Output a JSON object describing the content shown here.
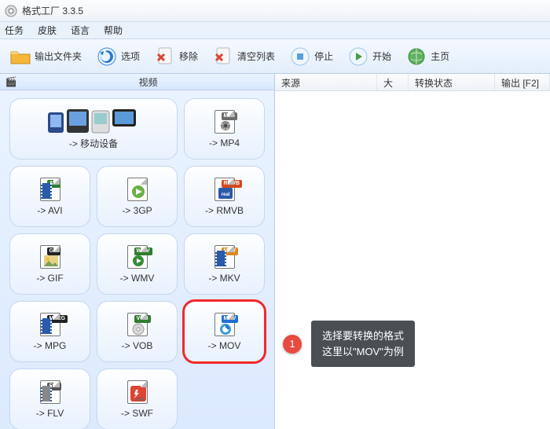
{
  "window": {
    "title": "格式工厂 3.3.5"
  },
  "menu": {
    "task": "任务",
    "skin": "皮肤",
    "lang": "语言",
    "help": "帮助"
  },
  "toolbar": {
    "output": "输出文件夹",
    "options": "选项",
    "remove": "移除",
    "clear": "清空列表",
    "stop": "停止",
    "start": "开始",
    "home": "主页"
  },
  "left": {
    "header": "视频"
  },
  "tiles": {
    "mobile": "-> 移动设备",
    "mp4": "-> MP4",
    "avi": "-> AVI",
    "3gp": "-> 3GP",
    "rmvb": "-> RMVB",
    "gif": "-> GIF",
    "wmv": "-> WMV",
    "mkv": "-> MKV",
    "mpg": "-> MPG",
    "vob": "-> VOB",
    "mov": "-> MOV",
    "flv": "-> FLV",
    "swf": "-> SWF"
  },
  "badges": {
    "mp4": "MP4",
    "avi": "AVI",
    "rmvb": "RMVB",
    "gif": "GIF",
    "wmv": "WMV",
    "mkv": "MKV",
    "mpg": "MPEG",
    "vob": "VOB",
    "mov": "MOV",
    "flv": "FLV"
  },
  "columns": {
    "source": "来源",
    "size": "大小",
    "status": "转换状态",
    "output": "输出 [F2]"
  },
  "callout": {
    "num": "1",
    "line1": "选择要转换的格式",
    "line2": "这里以\"MOV\"为例"
  },
  "colors": {
    "badge_mp4": "#6b6b6b",
    "badge_avi": "#2f7d2f",
    "badge_rmvb": "#d24a1f",
    "badge_gif": "#222",
    "badge_wmv": "#2f7d2f",
    "badge_mkv": "#d88a1f",
    "badge_mpg": "#222",
    "badge_vob": "#2f7d2f",
    "badge_mov": "#1f6fd2",
    "badge_flv": "#555"
  }
}
